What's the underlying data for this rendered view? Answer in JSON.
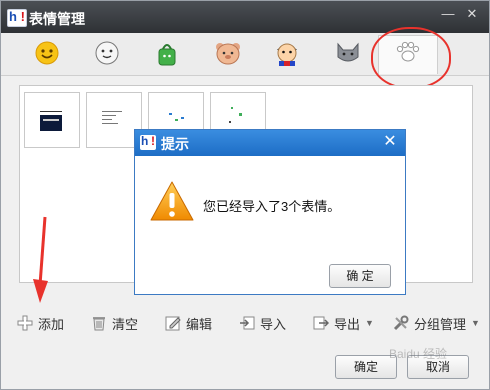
{
  "window": {
    "title": "表情管理"
  },
  "tabs": [
    {
      "icon": "smiley-icon",
      "active": false
    },
    {
      "icon": "white-face-icon",
      "active": false
    },
    {
      "icon": "green-bag-icon",
      "active": false
    },
    {
      "icon": "bear-icon",
      "active": false
    },
    {
      "icon": "cartoon-boy-icon",
      "active": false
    },
    {
      "icon": "cat-icon",
      "active": false
    },
    {
      "icon": "paw-icon",
      "active": true
    }
  ],
  "toolbar": {
    "add_label": "添加",
    "clear_label": "清空",
    "edit_label": "编辑",
    "import_label": "导入",
    "export_label": "导出",
    "group_label": "分组管理"
  },
  "footer": {
    "ok_label": "确定",
    "cancel_label": "取消"
  },
  "dialog": {
    "title": "提示",
    "message": "您已经导入了3个表情。",
    "ok_label": "确 定",
    "close_symbol": "✕"
  },
  "watermark": "Baidu 经验"
}
